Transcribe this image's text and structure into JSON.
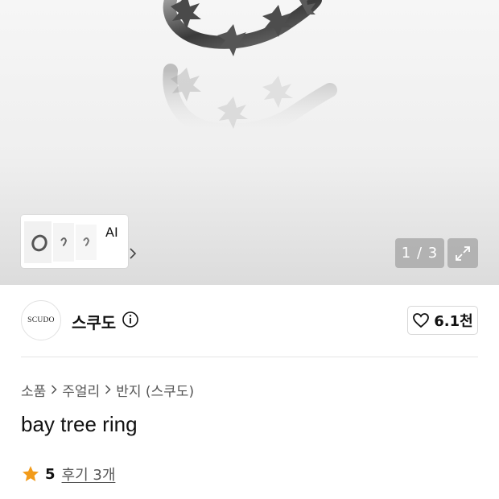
{
  "gallery": {
    "ai_label": "AI",
    "counter": "1 / 3"
  },
  "brand": {
    "logo_text": "SCUDO",
    "name": "스쿠도",
    "likes": "6.1천"
  },
  "breadcrumb": [
    "소품",
    "주얼리",
    "반지 (스쿠도)"
  ],
  "product": {
    "title": "bay tree ring",
    "rating": "5",
    "reviews": "후기 3개"
  },
  "colors": {
    "star": "#f29b1a",
    "text": "#111111",
    "muted": "#555555"
  }
}
